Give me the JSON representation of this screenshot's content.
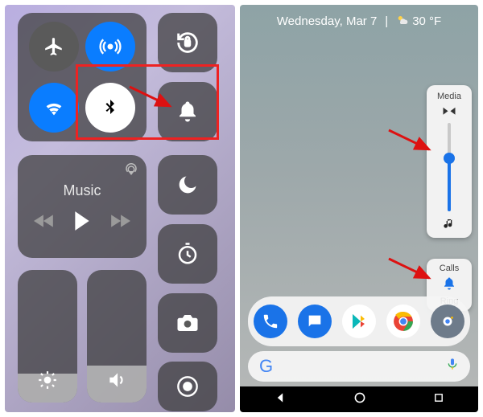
{
  "ios": {
    "music_label": "Music",
    "brightness_pct": 22,
    "volume_pct": 28
  },
  "android": {
    "date": "Wednesday, Mar 7",
    "temp": "30 °F",
    "media_label": "Media",
    "media_volume_pct": 60,
    "calls_label": "Calls",
    "ring_label": "Ring",
    "search_label": "G"
  }
}
